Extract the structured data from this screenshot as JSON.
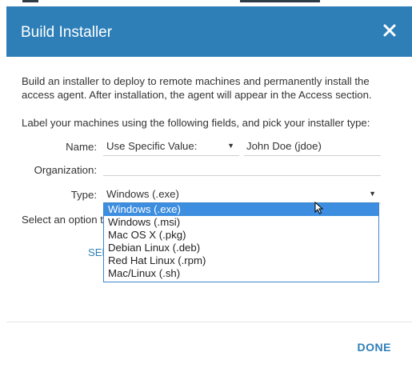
{
  "dialog": {
    "title": "Build Installer",
    "intro": "Build an installer to deploy to remote machines and permanently install the access agent. After installation, the agent will appear in the Access section.",
    "instructions": "Label your machines using the following fields, and pick your installer type:",
    "done_label": "DONE",
    "close_icon": "close-icon"
  },
  "form": {
    "name_label": "Name:",
    "name_mode": "Use Specific Value:",
    "name_value": "John Doe (jdoe)",
    "org_label": "Organization:",
    "org_value": "",
    "type_label": "Type:",
    "type_value": "Windows (.exe)",
    "type_options": [
      "Windows (.exe)",
      "Windows (.msi)",
      "Mac OS X (.pkg)",
      "Debian Linux (.deb)",
      "Red Hat Linux (.rpm)",
      "Mac/Linux (.sh)"
    ],
    "selected_option_index": 0
  },
  "behind": {
    "select_option_text": "Select an option t",
    "select_button_fragment": "SEl"
  },
  "colors": {
    "header": "#2e7fb8",
    "accent": "#2e7fb8",
    "selected_option": "#3d8ee0"
  }
}
